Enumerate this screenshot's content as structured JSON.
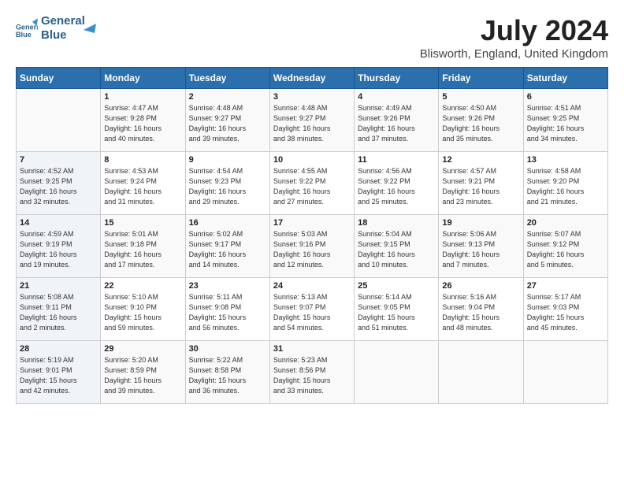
{
  "logo": {
    "line1": "General",
    "line2": "Blue"
  },
  "title": "July 2024",
  "location": "Blisworth, England, United Kingdom",
  "weekdays": [
    "Sunday",
    "Monday",
    "Tuesday",
    "Wednesday",
    "Thursday",
    "Friday",
    "Saturday"
  ],
  "weeks": [
    [
      {
        "day": "",
        "info": ""
      },
      {
        "day": "1",
        "info": "Sunrise: 4:47 AM\nSunset: 9:28 PM\nDaylight: 16 hours\nand 40 minutes."
      },
      {
        "day": "2",
        "info": "Sunrise: 4:48 AM\nSunset: 9:27 PM\nDaylight: 16 hours\nand 39 minutes."
      },
      {
        "day": "3",
        "info": "Sunrise: 4:48 AM\nSunset: 9:27 PM\nDaylight: 16 hours\nand 38 minutes."
      },
      {
        "day": "4",
        "info": "Sunrise: 4:49 AM\nSunset: 9:26 PM\nDaylight: 16 hours\nand 37 minutes."
      },
      {
        "day": "5",
        "info": "Sunrise: 4:50 AM\nSunset: 9:26 PM\nDaylight: 16 hours\nand 35 minutes."
      },
      {
        "day": "6",
        "info": "Sunrise: 4:51 AM\nSunset: 9:25 PM\nDaylight: 16 hours\nand 34 minutes."
      }
    ],
    [
      {
        "day": "7",
        "info": "Sunrise: 4:52 AM\nSunset: 9:25 PM\nDaylight: 16 hours\nand 32 minutes."
      },
      {
        "day": "8",
        "info": "Sunrise: 4:53 AM\nSunset: 9:24 PM\nDaylight: 16 hours\nand 31 minutes."
      },
      {
        "day": "9",
        "info": "Sunrise: 4:54 AM\nSunset: 9:23 PM\nDaylight: 16 hours\nand 29 minutes."
      },
      {
        "day": "10",
        "info": "Sunrise: 4:55 AM\nSunset: 9:22 PM\nDaylight: 16 hours\nand 27 minutes."
      },
      {
        "day": "11",
        "info": "Sunrise: 4:56 AM\nSunset: 9:22 PM\nDaylight: 16 hours\nand 25 minutes."
      },
      {
        "day": "12",
        "info": "Sunrise: 4:57 AM\nSunset: 9:21 PM\nDaylight: 16 hours\nand 23 minutes."
      },
      {
        "day": "13",
        "info": "Sunrise: 4:58 AM\nSunset: 9:20 PM\nDaylight: 16 hours\nand 21 minutes."
      }
    ],
    [
      {
        "day": "14",
        "info": "Sunrise: 4:59 AM\nSunset: 9:19 PM\nDaylight: 16 hours\nand 19 minutes."
      },
      {
        "day": "15",
        "info": "Sunrise: 5:01 AM\nSunset: 9:18 PM\nDaylight: 16 hours\nand 17 minutes."
      },
      {
        "day": "16",
        "info": "Sunrise: 5:02 AM\nSunset: 9:17 PM\nDaylight: 16 hours\nand 14 minutes."
      },
      {
        "day": "17",
        "info": "Sunrise: 5:03 AM\nSunset: 9:16 PM\nDaylight: 16 hours\nand 12 minutes."
      },
      {
        "day": "18",
        "info": "Sunrise: 5:04 AM\nSunset: 9:15 PM\nDaylight: 16 hours\nand 10 minutes."
      },
      {
        "day": "19",
        "info": "Sunrise: 5:06 AM\nSunset: 9:13 PM\nDaylight: 16 hours\nand 7 minutes."
      },
      {
        "day": "20",
        "info": "Sunrise: 5:07 AM\nSunset: 9:12 PM\nDaylight: 16 hours\nand 5 minutes."
      }
    ],
    [
      {
        "day": "21",
        "info": "Sunrise: 5:08 AM\nSunset: 9:11 PM\nDaylight: 16 hours\nand 2 minutes."
      },
      {
        "day": "22",
        "info": "Sunrise: 5:10 AM\nSunset: 9:10 PM\nDaylight: 15 hours\nand 59 minutes."
      },
      {
        "day": "23",
        "info": "Sunrise: 5:11 AM\nSunset: 9:08 PM\nDaylight: 15 hours\nand 56 minutes."
      },
      {
        "day": "24",
        "info": "Sunrise: 5:13 AM\nSunset: 9:07 PM\nDaylight: 15 hours\nand 54 minutes."
      },
      {
        "day": "25",
        "info": "Sunrise: 5:14 AM\nSunset: 9:05 PM\nDaylight: 15 hours\nand 51 minutes."
      },
      {
        "day": "26",
        "info": "Sunrise: 5:16 AM\nSunset: 9:04 PM\nDaylight: 15 hours\nand 48 minutes."
      },
      {
        "day": "27",
        "info": "Sunrise: 5:17 AM\nSunset: 9:03 PM\nDaylight: 15 hours\nand 45 minutes."
      }
    ],
    [
      {
        "day": "28",
        "info": "Sunrise: 5:19 AM\nSunset: 9:01 PM\nDaylight: 15 hours\nand 42 minutes."
      },
      {
        "day": "29",
        "info": "Sunrise: 5:20 AM\nSunset: 8:59 PM\nDaylight: 15 hours\nand 39 minutes."
      },
      {
        "day": "30",
        "info": "Sunrise: 5:22 AM\nSunset: 8:58 PM\nDaylight: 15 hours\nand 36 minutes."
      },
      {
        "day": "31",
        "info": "Sunrise: 5:23 AM\nSunset: 8:56 PM\nDaylight: 15 hours\nand 33 minutes."
      },
      {
        "day": "",
        "info": ""
      },
      {
        "day": "",
        "info": ""
      },
      {
        "day": "",
        "info": ""
      }
    ]
  ]
}
